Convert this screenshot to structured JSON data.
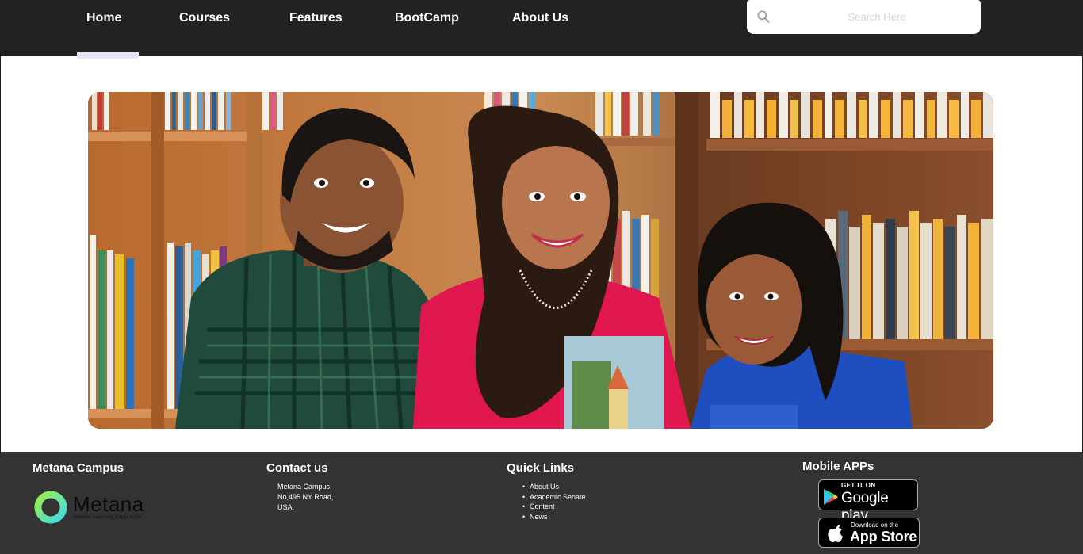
{
  "nav": {
    "items": [
      {
        "label": "Home"
      },
      {
        "label": "Courses"
      },
      {
        "label": "Features"
      },
      {
        "label": "BootCamp"
      },
      {
        "label": "About Us"
      }
    ],
    "active_index": 0
  },
  "search": {
    "placeholder": "Search Here",
    "value": "",
    "icon": "search-icon"
  },
  "hero": {
    "image_alt": "Three smiling students in a library"
  },
  "footer": {
    "campus": {
      "title": "Metana Campus",
      "logo_text": "Metana",
      "logo_tagline": "Smarter Learning Experience"
    },
    "contact": {
      "title": "Contact us",
      "lines": [
        "Metana Campus,",
        "No,495 NY Road,",
        "USA,"
      ]
    },
    "quick_links": {
      "title": "Quick Links",
      "items": [
        "About Us",
        "Academic Senate",
        "Content",
        "News"
      ]
    },
    "mobile_apps": {
      "title": "Mobile APPs",
      "google_play": {
        "small": "GET IT ON",
        "big": "Google play"
      },
      "app_store": {
        "small": "Download on the",
        "big": "App Store"
      }
    }
  },
  "colors": {
    "nav_bg": "#222222",
    "footer_bg": "#333333",
    "active_underline": "#e8e4f5",
    "logo_gradient_start": "#9cf04a",
    "logo_gradient_end": "#3fd9e8"
  }
}
